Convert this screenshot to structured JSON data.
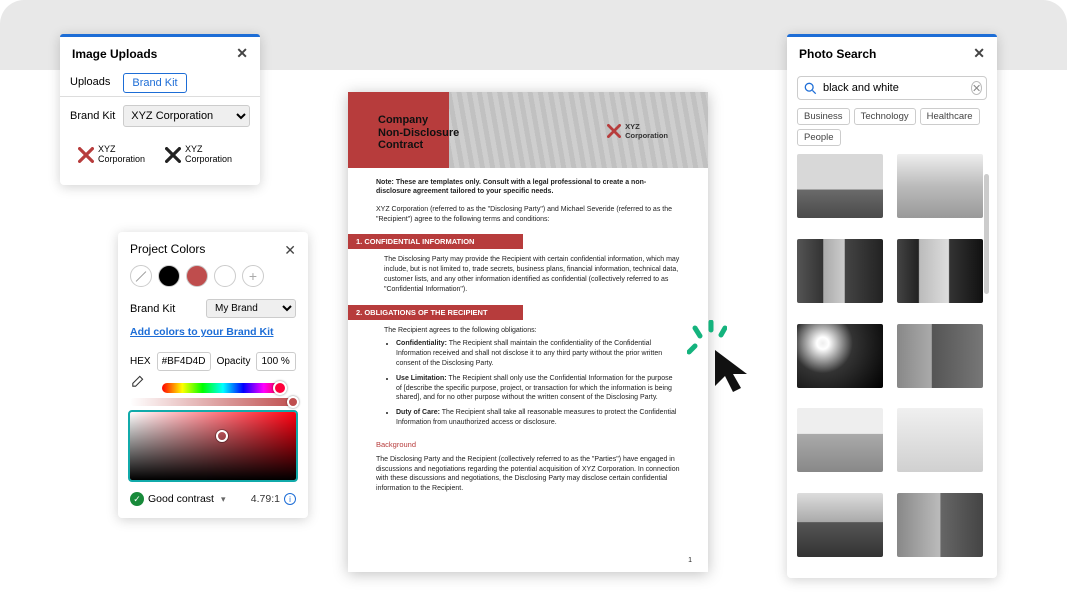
{
  "imageUploads": {
    "title": "Image Uploads",
    "tabs": [
      "Uploads",
      "Brand Kit"
    ],
    "activeTab": 1,
    "brandKitLabel": "Brand Kit",
    "brandKitSelect": "XYZ Corporation",
    "logos": [
      "XYZ\nCorporation",
      "XYZ\nCorporation"
    ]
  },
  "projectColors": {
    "title": "Project Colors",
    "swatches": [
      {
        "type": "none"
      },
      {
        "color": "#000000"
      },
      {
        "color": "#BF4D4D"
      },
      {
        "color": "#FFFFFF"
      },
      {
        "type": "add"
      }
    ],
    "brandKitLabel": "Brand Kit",
    "brandSelect": "My Brand",
    "addColorsLink": "Add colors to your Brand Kit",
    "hexLabel": "HEX",
    "hexValue": "#BF4D4D",
    "opacityLabel": "Opacity",
    "opacityValue": "100 %",
    "contrastLabel": "Good contrast",
    "contrastRatio": "4.79:1"
  },
  "photoSearch": {
    "title": "Photo Search",
    "query": "black and white",
    "chips": [
      "Business",
      "Technology",
      "Healthcare",
      "People"
    ]
  },
  "document": {
    "title": "Company\nNon-Disclosure\nContract",
    "logoText": "XYZ\nCorporation",
    "note": "Note: These are templates only. Consult with a legal professional to create a non-disclosure agreement tailored to your specific needs.",
    "intro": "XYZ Corporation (referred to as the \"Disclosing Party\") and Michael Severide (referred to as the \"Recipient\") agree to the following terms and conditions:",
    "sec1": {
      "head": "1. CONFIDENTIAL INFORMATION",
      "body": "The Disclosing Party may provide the Recipient with certain confidential information, which may include, but is not limited to, trade secrets, business plans, financial information, technical data, customer lists, and any other information identified as confidential (collectively referred to as \"Confidential Information\")."
    },
    "sec2": {
      "head": "2. OBLIGATIONS OF THE RECIPIENT",
      "intro": "The Recipient agrees to the following obligations:",
      "items": [
        {
          "b": "Confidentiality:",
          "t": " The Recipient shall maintain the confidentiality of the Confidential Information received and shall not disclose it to any third party without the prior written consent of the Disclosing Party."
        },
        {
          "b": "Use Limitation:",
          "t": " The Recipient shall only use the Confidential Information for the purpose of [describe the specific purpose, project, or transaction for which the information is being shared], and for no other purpose without the written consent of the Disclosing Party."
        },
        {
          "b": "Duty of Care:",
          "t": " The Recipient shall take all reasonable measures to protect the Confidential Information from unauthorized access or disclosure."
        }
      ]
    },
    "bg": {
      "head": "Background",
      "body": "The Disclosing Party and the Recipient (collectively referred to as the \"Parties\") have engaged in discussions and negotiations regarding the potential acquisition of XYZ Corporation. In connection with these discussions and negotiations, the Disclosing Party may disclose certain confidential information to the Recipient."
    },
    "pageNum": "1"
  }
}
